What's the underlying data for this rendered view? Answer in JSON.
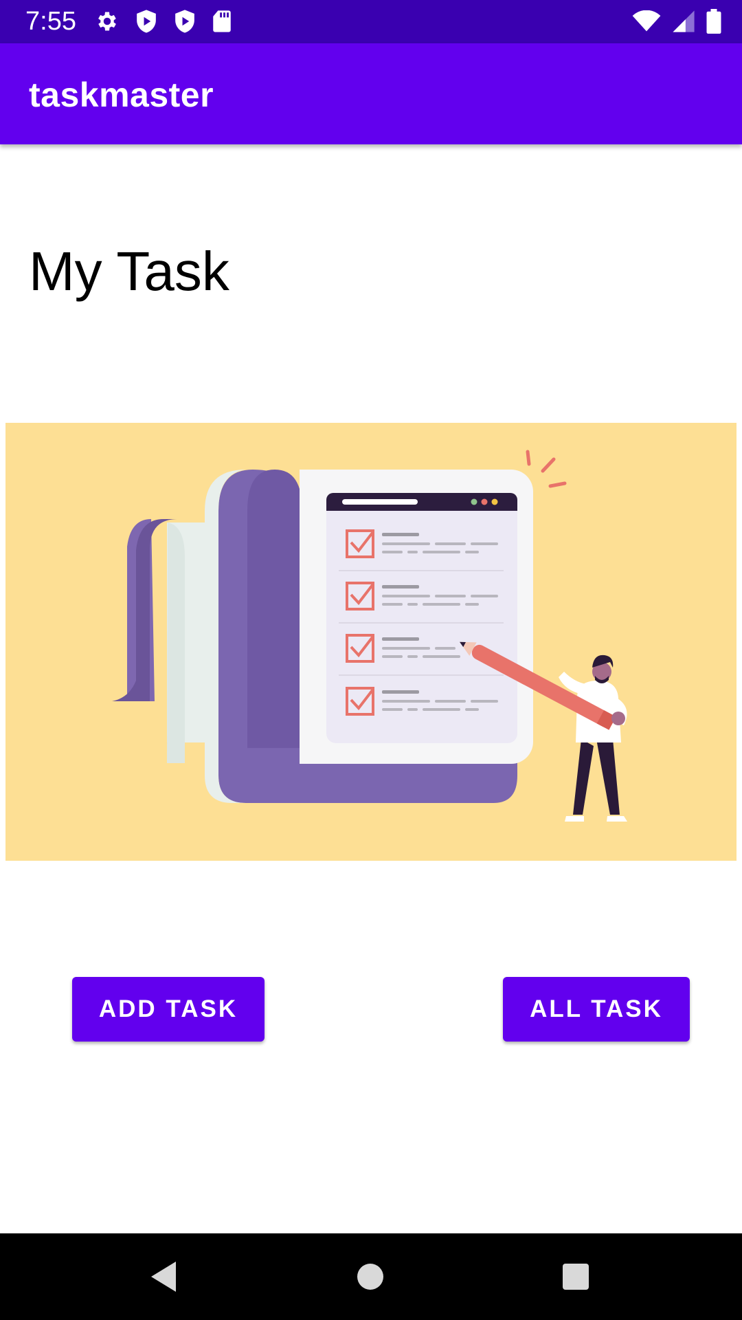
{
  "status_bar": {
    "time": "7:55",
    "left_icons": [
      "settings-icon",
      "shield-play-icon",
      "shield-play-icon",
      "sd-card-icon"
    ],
    "right_icons": [
      "wifi-icon",
      "cellular-signal-icon",
      "battery-icon"
    ],
    "background": "#3a00b0"
  },
  "app_bar": {
    "title": "taskmaster",
    "background": "#6200ee"
  },
  "main": {
    "heading": "My Task",
    "illustration": {
      "description_icon": "task-checklist-illustration",
      "background": "#fddf94"
    },
    "buttons": {
      "add_task": "ADD TASK",
      "all_task": "ALL TASK"
    }
  },
  "nav_bar": {
    "icons": [
      "back-icon",
      "home-icon",
      "recents-icon"
    ]
  },
  "colors": {
    "primary": "#6200ee",
    "primary_dark": "#3a00b0",
    "accent_check": "#e8736a"
  }
}
